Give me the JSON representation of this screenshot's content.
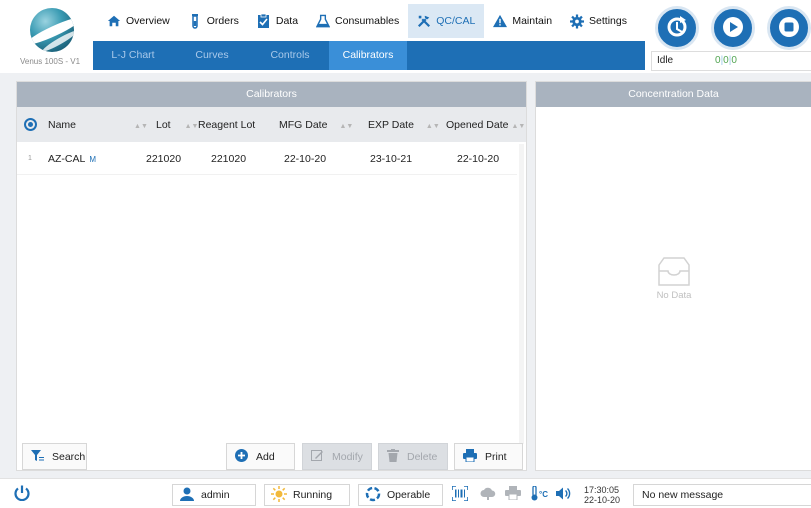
{
  "app": {
    "version": "Venus 100S - V1"
  },
  "nav": [
    {
      "label": "Overview",
      "icon": "home-icon"
    },
    {
      "label": "Orders",
      "icon": "test-tube-icon"
    },
    {
      "label": "Data",
      "icon": "clipboard-icon"
    },
    {
      "label": "Consumables",
      "icon": "flask-icon"
    },
    {
      "label": "QC/CAL",
      "icon": "tools-icon",
      "active": true
    },
    {
      "label": "Maintain",
      "icon": "warning-icon"
    },
    {
      "label": "Settings",
      "icon": "gear-icon"
    }
  ],
  "subnav": [
    {
      "label": "L-J Chart"
    },
    {
      "label": "Curves"
    },
    {
      "label": "Controls"
    },
    {
      "label": "Calibrators",
      "selected": true
    }
  ],
  "status": {
    "state": "Idle",
    "counts": [
      "0",
      "0",
      "0"
    ]
  },
  "calibrators": {
    "title": "Calibrators",
    "columns": [
      "Name",
      "Lot",
      "Reagent Lot",
      "MFG Date",
      "EXP Date",
      "Opened Date"
    ],
    "rows": [
      {
        "index": "1",
        "name": "AZ-CAL",
        "mark": "M",
        "lot": "221020",
        "reagent_lot": "221020",
        "mfg": "22-10-20",
        "exp": "23-10-21",
        "opened": "22-10-20"
      }
    ],
    "buttons": {
      "search": "Search",
      "add": "Add",
      "modify": "Modify",
      "delete": "Delete",
      "print": "Print"
    }
  },
  "concentration": {
    "title": "Concentration Data",
    "empty": "No Data"
  },
  "footer": {
    "user": "admin",
    "run_state": "Running",
    "operable": "Operable",
    "time": "17:30:05",
    "date": "22-10-20",
    "message": "No new message"
  },
  "colors": {
    "primary": "#1e6fb5",
    "panel_header": "#a9b3bf",
    "subnav_selected": "#3a8fd8"
  }
}
